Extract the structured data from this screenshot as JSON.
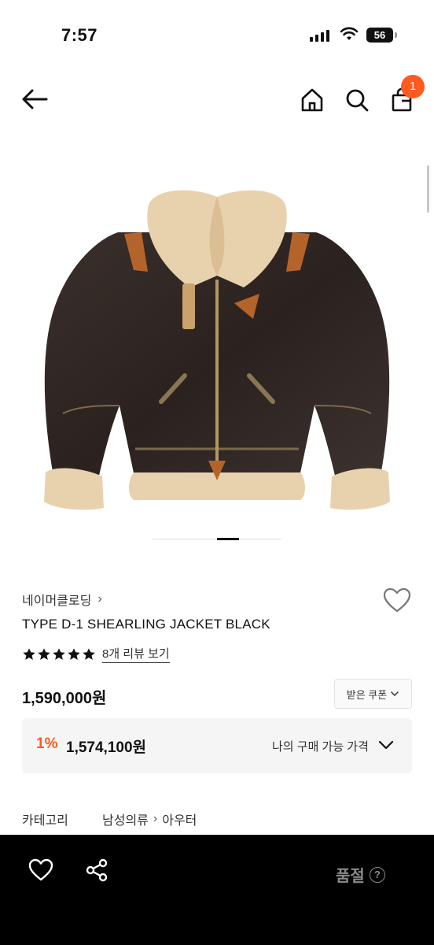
{
  "status_bar": {
    "time": "7:57",
    "battery": "56"
  },
  "header": {
    "cart_count": "1"
  },
  "product": {
    "brand": "네이머클로딩",
    "name": "TYPE D-1 SHEARLING JACKET BLACK",
    "rating_stars": 5,
    "review_link": "8개 리뷰 보기",
    "price": "1,590,000원",
    "coupon_button": "받은 쿠폰",
    "discount_rate": "1%",
    "discount_price": "1,574,100원",
    "mypurchase_label": "나의 구매 가능 가격"
  },
  "category": {
    "label": "카테고리",
    "path": [
      "남성의류",
      "아우터"
    ]
  },
  "bottom_bar": {
    "status": "품절"
  },
  "colors": {
    "accent": "#ff5a1f",
    "bottom_bar": "#000000"
  }
}
